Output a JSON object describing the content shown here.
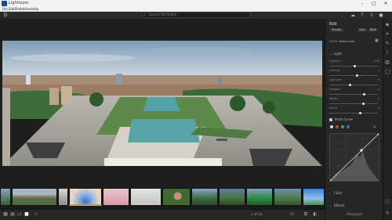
{
  "window": {
    "title": "Lightroom",
    "minimize": "–",
    "maximize": "□",
    "close": "✕"
  },
  "menu": [
    "File",
    "Edit",
    "Photo",
    "View",
    "Help"
  ],
  "search": {
    "placeholder": "Search All Photos"
  },
  "panel": {
    "title": "Edit",
    "preset_label": "Presets",
    "auto_label": "Auto",
    "bw_label": "B&W",
    "profile_label": "Profile",
    "profile_value": "Adobe Color",
    "light_section": "Light",
    "sliders": [
      {
        "label": "Exposure",
        "value": "0.00",
        "level": 0.5
      },
      {
        "label": "Contrast",
        "value": "0",
        "level": 0.55
      },
      {
        "label": "Highlights",
        "value": "0",
        "level": 0.4
      },
      {
        "label": "Shadows",
        "value": "0",
        "level": 0.7
      },
      {
        "label": "Whites",
        "value": "0",
        "level": 0.68
      },
      {
        "label": "Blacks",
        "value": "0",
        "level": 0.62
      }
    ],
    "curve_label": "Point Curve",
    "color_section": "Color",
    "effects_section": "Effects"
  },
  "filmstrip": {
    "zoom_label": "Fit",
    "sort_label": "Sort"
  },
  "bottom": {
    "info": "1 of 34",
    "right": "Histogram"
  },
  "colors": {
    "accent": "#2d8ceb",
    "panel_bg": "#262626",
    "canvas_bg": "#1e1e1e"
  }
}
